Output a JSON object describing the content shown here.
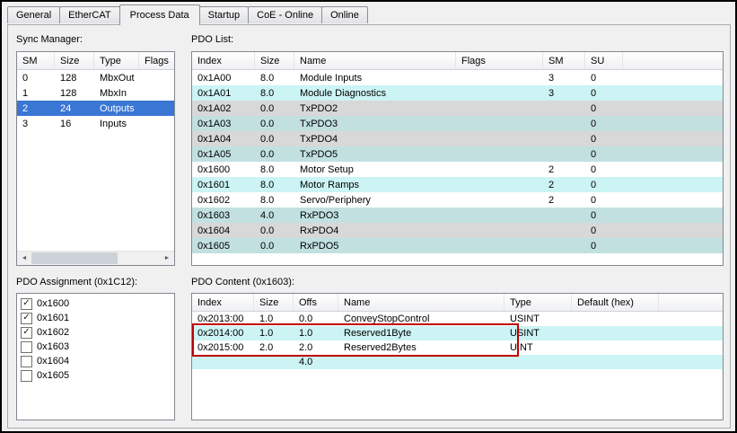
{
  "tabs": [
    {
      "label": "General",
      "active": false
    },
    {
      "label": "EtherCAT",
      "active": false
    },
    {
      "label": "Process Data",
      "active": true
    },
    {
      "label": "Startup",
      "active": false
    },
    {
      "label": "CoE - Online",
      "active": false
    },
    {
      "label": "Online",
      "active": false
    }
  ],
  "icons": {
    "scroll_left": "◄",
    "scroll_right": "►",
    "check": "✓"
  },
  "colors": {
    "selection_blue": "#3a76d3",
    "row_cyan": "#ccf4f4",
    "row_gray": "#d8d8d8",
    "row_graycyan": "#c2e0e0",
    "highlight_red": "#c00000"
  },
  "sync_manager": {
    "label": "Sync Manager:",
    "columns": [
      "SM",
      "Size",
      "Type",
      "Flags"
    ],
    "rows": [
      {
        "sm": "0",
        "size": "128",
        "type": "MbxOut",
        "flags": "",
        "selected": false
      },
      {
        "sm": "1",
        "size": "128",
        "type": "MbxIn",
        "flags": "",
        "selected": false
      },
      {
        "sm": "2",
        "size": "24",
        "type": "Outputs",
        "flags": "",
        "selected": true
      },
      {
        "sm": "3",
        "size": "16",
        "type": "Inputs",
        "flags": "",
        "selected": false
      }
    ]
  },
  "pdo_list": {
    "label": "PDO List:",
    "columns": [
      "Index",
      "Size",
      "Name",
      "Flags",
      "SM",
      "SU"
    ],
    "rows": [
      {
        "index": "0x1A00",
        "size": "8.0",
        "name": "Module Inputs",
        "flags": "",
        "sm": "3",
        "su": "0"
      },
      {
        "index": "0x1A01",
        "size": "8.0",
        "name": "Module Diagnostics",
        "flags": "",
        "sm": "3",
        "su": "0"
      },
      {
        "index": "0x1A02",
        "size": "0.0",
        "name": "TxPDO2",
        "flags": "",
        "sm": "",
        "su": "0"
      },
      {
        "index": "0x1A03",
        "size": "0.0",
        "name": "TxPDO3",
        "flags": "",
        "sm": "",
        "su": "0"
      },
      {
        "index": "0x1A04",
        "size": "0.0",
        "name": "TxPDO4",
        "flags": "",
        "sm": "",
        "su": "0"
      },
      {
        "index": "0x1A05",
        "size": "0.0",
        "name": "TxPDO5",
        "flags": "",
        "sm": "",
        "su": "0"
      },
      {
        "index": "0x1600",
        "size": "8.0",
        "name": "Motor Setup",
        "flags": "",
        "sm": "2",
        "su": "0"
      },
      {
        "index": "0x1601",
        "size": "8.0",
        "name": "Motor Ramps",
        "flags": "",
        "sm": "2",
        "su": "0"
      },
      {
        "index": "0x1602",
        "size": "8.0",
        "name": "Servo/Periphery",
        "flags": "",
        "sm": "2",
        "su": "0"
      },
      {
        "index": "0x1603",
        "size": "4.0",
        "name": "RxPDO3",
        "flags": "",
        "sm": "",
        "su": "0"
      },
      {
        "index": "0x1604",
        "size": "0.0",
        "name": "RxPDO4",
        "flags": "",
        "sm": "",
        "su": "0"
      },
      {
        "index": "0x1605",
        "size": "0.0",
        "name": "RxPDO5",
        "flags": "",
        "sm": "",
        "su": "0"
      }
    ]
  },
  "pdo_assignment": {
    "label": "PDO Assignment (0x1C12):",
    "items": [
      {
        "label": "0x1600",
        "checked": true
      },
      {
        "label": "0x1601",
        "checked": true
      },
      {
        "label": "0x1602",
        "checked": true
      },
      {
        "label": "0x1603",
        "checked": false
      },
      {
        "label": "0x1604",
        "checked": false
      },
      {
        "label": "0x1605",
        "checked": false
      }
    ]
  },
  "pdo_content": {
    "label": "PDO Content (0x1603):",
    "columns": [
      "Index",
      "Size",
      "Offs",
      "Name",
      "Type",
      "Default (hex)"
    ],
    "rows": [
      {
        "index": "0x2013:00",
        "size": "1.0",
        "offs": "0.0",
        "name": "ConveyStopControl",
        "type": "USINT",
        "default": "",
        "highlighted": false
      },
      {
        "index": "0x2014:00",
        "size": "1.0",
        "offs": "1.0",
        "name": "Reserved1Byte",
        "type": "USINT",
        "default": "",
        "highlighted": true
      },
      {
        "index": "0x2015:00",
        "size": "2.0",
        "offs": "2.0",
        "name": "Reserved2Bytes",
        "type": "UINT",
        "default": "",
        "highlighted": true
      },
      {
        "index": "",
        "size": "",
        "offs": "4.0",
        "name": "",
        "type": "",
        "default": "",
        "highlighted": false
      }
    ]
  }
}
